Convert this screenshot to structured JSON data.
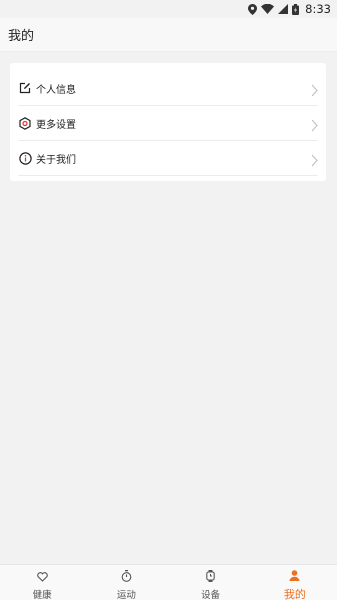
{
  "status_bar": {
    "time": "8:33"
  },
  "header": {
    "title": "我的"
  },
  "menu": {
    "items": [
      {
        "label": "个人信息",
        "icon": "edit-icon"
      },
      {
        "label": "更多设置",
        "icon": "settings-hexagon-icon"
      },
      {
        "label": "关于我们",
        "icon": "info-icon"
      }
    ]
  },
  "tabs": [
    {
      "label": "健康",
      "icon": "heart-icon"
    },
    {
      "label": "运动",
      "icon": "stopwatch-icon"
    },
    {
      "label": "设备",
      "icon": "watch-icon"
    },
    {
      "label": "我的",
      "icon": "person-icon",
      "active": true
    }
  ],
  "colors": {
    "accent": "#f07020",
    "background": "#f2f2f2"
  }
}
